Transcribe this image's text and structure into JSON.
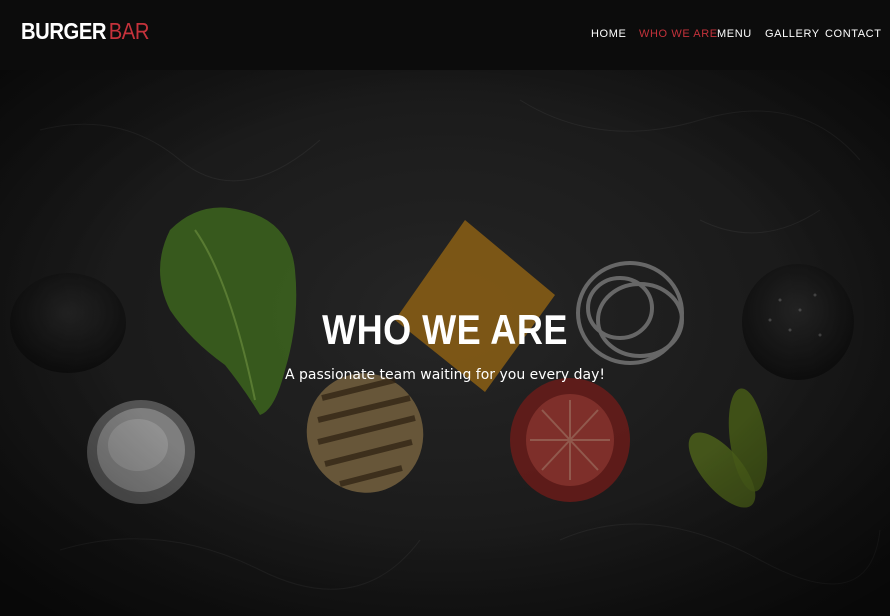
{
  "brand": {
    "part1": "BURGER",
    "part2": "BAR"
  },
  "nav": {
    "items": [
      {
        "label": "HOME",
        "active": false
      },
      {
        "label": "WHO WE ARE",
        "active": true
      },
      {
        "label": "MENU",
        "active": false
      },
      {
        "label": "GALLERY",
        "active": false
      },
      {
        "label": "CONTACT",
        "active": false
      }
    ]
  },
  "hero": {
    "title": "WHO WE ARE",
    "subtitle": "A passionate team waiting for you every day!"
  },
  "colors": {
    "accent": "#c5323b",
    "navbar": "#0c0c0c",
    "text": "#ffffff"
  }
}
